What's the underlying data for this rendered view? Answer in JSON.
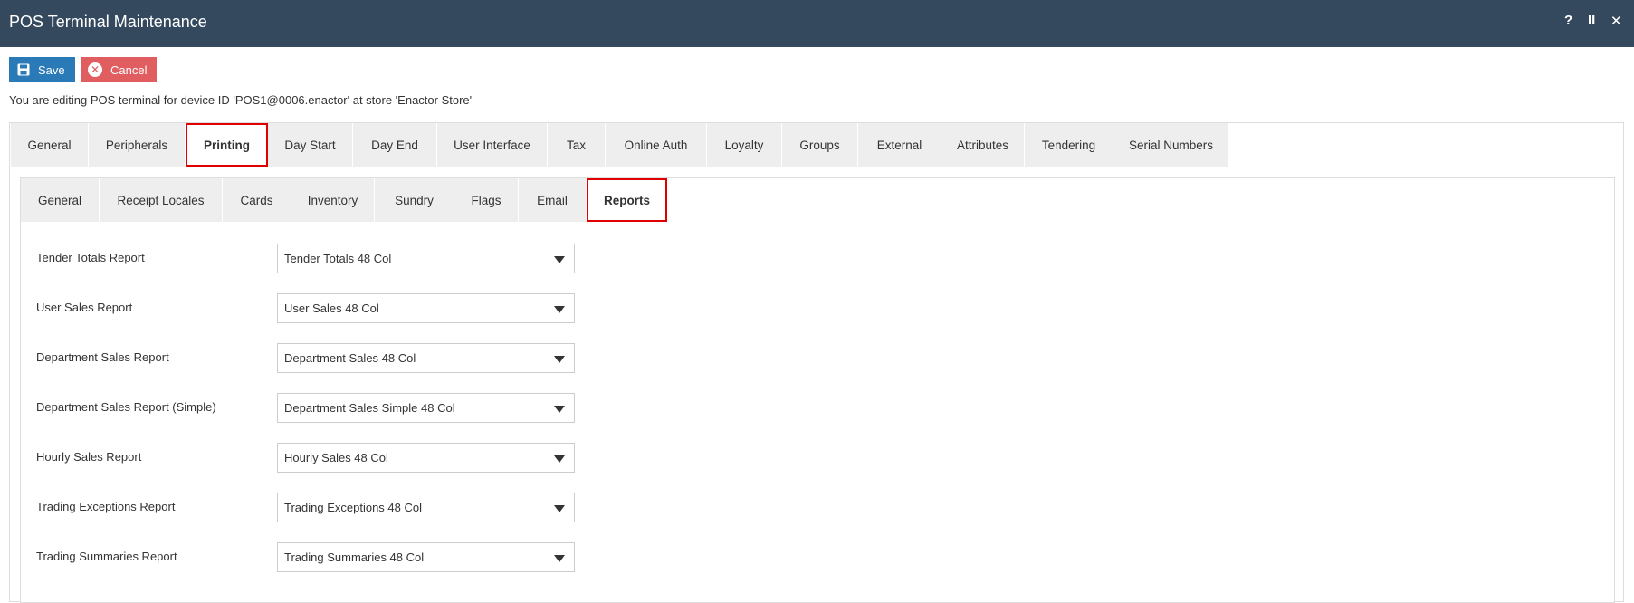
{
  "window": {
    "title": "POS Terminal Maintenance",
    "help_label": "?",
    "pause_label": "II",
    "close_label": "✕"
  },
  "toolbar": {
    "save_label": "Save",
    "cancel_label": "Cancel"
  },
  "info_text": "You are editing POS terminal for device ID 'POS1@0006.enactor' at store 'Enactor Store'",
  "main_tabs": [
    {
      "label": "General",
      "width": 86
    },
    {
      "label": "Peripherals",
      "width": 107
    },
    {
      "label": "Printing",
      "width": 91,
      "active": true
    },
    {
      "label": "Day Start",
      "width": 94
    },
    {
      "label": "Day End",
      "width": 93
    },
    {
      "label": "User Interface",
      "width": 122
    },
    {
      "label": "Tax",
      "width": 64
    },
    {
      "label": "Online Auth",
      "width": 112
    },
    {
      "label": "Loyalty",
      "width": 83
    },
    {
      "label": "Groups",
      "width": 84
    },
    {
      "label": "External",
      "width": 92
    },
    {
      "label": "Attributes",
      "width": 92
    },
    {
      "label": "Tendering",
      "width": 98
    },
    {
      "label": "Serial Numbers",
      "width": 128
    }
  ],
  "sub_tabs": [
    {
      "label": "General",
      "width": 87
    },
    {
      "label": "Receipt Locales",
      "width": 136
    },
    {
      "label": "Cards",
      "width": 76
    },
    {
      "label": "Inventory",
      "width": 92
    },
    {
      "label": "Sundry",
      "width": 88
    },
    {
      "label": "Flags",
      "width": 71
    },
    {
      "label": "Email",
      "width": 75
    },
    {
      "label": "Reports",
      "width": 89,
      "active": true
    }
  ],
  "reports": [
    {
      "label": "Tender Totals Report",
      "value": "Tender Totals 48 Col"
    },
    {
      "label": "User Sales Report",
      "value": "User Sales 48 Col"
    },
    {
      "label": "Department Sales Report",
      "value": "Department Sales 48 Col"
    },
    {
      "label": "Department Sales Report (Simple)",
      "value": "Department Sales Simple 48 Col"
    },
    {
      "label": "Hourly Sales Report",
      "value": "Hourly Sales 48 Col"
    },
    {
      "label": "Trading Exceptions Report",
      "value": "Trading Exceptions 48 Col"
    },
    {
      "label": "Trading Summaries Report",
      "value": "Trading Summaries 48 Col"
    }
  ]
}
